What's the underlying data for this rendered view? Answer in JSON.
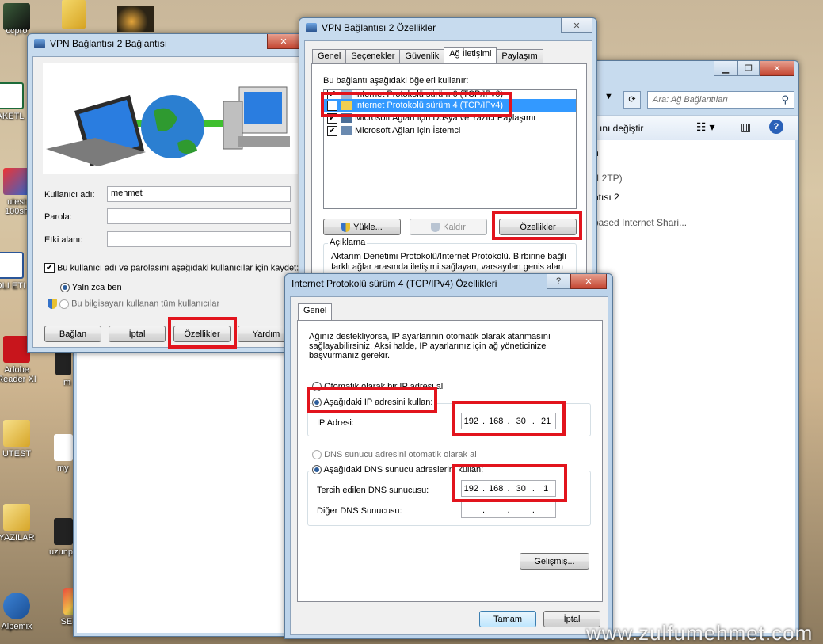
{
  "desktop": {
    "icons": [
      {
        "label": "ccpro"
      },
      {
        "label": "AKETL"
      },
      {
        "label": "utest\n100sh"
      },
      {
        "label": "OLI ETI"
      },
      {
        "label": "Adobe\nReader XI"
      },
      {
        "label": "UTEST"
      },
      {
        "label": "YAZILAR"
      },
      {
        "label": "Alpemix"
      },
      {
        "label": "m"
      },
      {
        "label": "my"
      },
      {
        "label": "uzunp"
      },
      {
        "label": "SE-VPN"
      }
    ],
    "watermark": "www.zulfumehmet.com"
  },
  "explorer": {
    "search_placeholder": "Ara: Ağ Bağlantıları",
    "toolbar_text": "ını değiştir",
    "items": [
      "n",
      "(L2TP)",
      "ntısı 2",
      "based Internet Shari..."
    ]
  },
  "vpn_connect": {
    "title": "VPN Bağlantısı 2 Bağlantısı",
    "username_label": "Kullanıcı adı:",
    "username_value": "mehmet",
    "password_label": "Parola:",
    "domain_label": "Etki alanı:",
    "save_checkbox_label": "Bu kullanıcı adı ve parolasını aşağıdaki kullanıcılar için kaydet:",
    "radio_me": "Yalnızca ben",
    "radio_all": "Bu bilgisayarı kullanan tüm kullanıcılar",
    "buttons": {
      "connect": "Bağlan",
      "cancel": "İptal",
      "properties": "Özellikler",
      "help": "Yardım"
    }
  },
  "vpn_props": {
    "title": "VPN Bağlantısı 2 Özellikler",
    "tabs": [
      "Genel",
      "Seçenekler",
      "Güvenlik",
      "Ağ İletişimi",
      "Paylaşım"
    ],
    "active_tab": "Ağ İletişimi",
    "items_label": "Bu bağlantı aşağıdaki öğeleri kullanır:",
    "items": [
      {
        "label": "Internet Protokolü sürüm 6 (TCP/IPv6)",
        "checked": true
      },
      {
        "label": "Internet Protokolü sürüm 4 (TCP/IPv4)",
        "checked": true,
        "selected": true
      },
      {
        "label": "Microsoft Ağları için Dosya ve Yazıcı Paylaşımı",
        "checked": true
      },
      {
        "label": "Microsoft Ağları için İstemci",
        "checked": true
      }
    ],
    "buttons": {
      "install": "Yükle...",
      "uninstall": "Kaldır",
      "properties": "Özellikler"
    },
    "description_title": "Açıklama",
    "description": "Aktarım Denetimi Protokolü/Internet Protokolü. Birbirine bağlı farklı ağlar arasında iletişimi sağlayan, varsayılan genis alan ağı"
  },
  "ipv4": {
    "title": "Internet Protokolü sürüm 4 (TCP/IPv4) Özellikleri",
    "tab": "Genel",
    "intro": "Ağınız destekliyorsa, IP ayarlarının otomatik olarak atanmasını sağlayabilirsiniz. Aksi halde, IP ayarlarınız için ağ yöneticinize başvurmanız gerekir.",
    "auto_ip": "Otomatik olarak bir IP adresi al",
    "manual_ip": "Aşağıdaki IP adresini kullan:",
    "ip_label": "IP Adresi:",
    "ip": [
      "192",
      "168",
      "30",
      "21"
    ],
    "auto_dns": "DNS sunucu adresini otomatik olarak al",
    "manual_dns": "Aşağıdaki DNS sunucu adreslerini kullan:",
    "pref_dns_label": "Tercih edilen DNS sunucusu:",
    "pref_dns": [
      "192",
      "168",
      "30",
      "1"
    ],
    "alt_dns_label": "Diğer DNS Sunucusu:",
    "advanced": "Gelişmiş...",
    "ok": "Tamam",
    "cancel": "İptal"
  }
}
